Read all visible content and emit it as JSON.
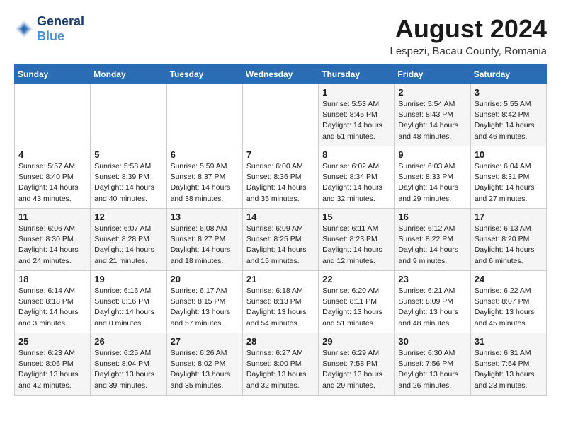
{
  "header": {
    "logo_line1": "General",
    "logo_line2": "Blue",
    "month_year": "August 2024",
    "location": "Lespezi, Bacau County, Romania"
  },
  "days_of_week": [
    "Sunday",
    "Monday",
    "Tuesday",
    "Wednesday",
    "Thursday",
    "Friday",
    "Saturday"
  ],
  "weeks": [
    [
      {
        "day": "",
        "sunrise": "",
        "sunset": "",
        "daylight": ""
      },
      {
        "day": "",
        "sunrise": "",
        "sunset": "",
        "daylight": ""
      },
      {
        "day": "",
        "sunrise": "",
        "sunset": "",
        "daylight": ""
      },
      {
        "day": "",
        "sunrise": "",
        "sunset": "",
        "daylight": ""
      },
      {
        "day": "1",
        "sunrise": "Sunrise: 5:53 AM",
        "sunset": "Sunset: 8:45 PM",
        "daylight": "Daylight: 14 hours and 51 minutes."
      },
      {
        "day": "2",
        "sunrise": "Sunrise: 5:54 AM",
        "sunset": "Sunset: 8:43 PM",
        "daylight": "Daylight: 14 hours and 48 minutes."
      },
      {
        "day": "3",
        "sunrise": "Sunrise: 5:55 AM",
        "sunset": "Sunset: 8:42 PM",
        "daylight": "Daylight: 14 hours and 46 minutes."
      }
    ],
    [
      {
        "day": "4",
        "sunrise": "Sunrise: 5:57 AM",
        "sunset": "Sunset: 8:40 PM",
        "daylight": "Daylight: 14 hours and 43 minutes."
      },
      {
        "day": "5",
        "sunrise": "Sunrise: 5:58 AM",
        "sunset": "Sunset: 8:39 PM",
        "daylight": "Daylight: 14 hours and 40 minutes."
      },
      {
        "day": "6",
        "sunrise": "Sunrise: 5:59 AM",
        "sunset": "Sunset: 8:37 PM",
        "daylight": "Daylight: 14 hours and 38 minutes."
      },
      {
        "day": "7",
        "sunrise": "Sunrise: 6:00 AM",
        "sunset": "Sunset: 8:36 PM",
        "daylight": "Daylight: 14 hours and 35 minutes."
      },
      {
        "day": "8",
        "sunrise": "Sunrise: 6:02 AM",
        "sunset": "Sunset: 8:34 PM",
        "daylight": "Daylight: 14 hours and 32 minutes."
      },
      {
        "day": "9",
        "sunrise": "Sunrise: 6:03 AM",
        "sunset": "Sunset: 8:33 PM",
        "daylight": "Daylight: 14 hours and 29 minutes."
      },
      {
        "day": "10",
        "sunrise": "Sunrise: 6:04 AM",
        "sunset": "Sunset: 8:31 PM",
        "daylight": "Daylight: 14 hours and 27 minutes."
      }
    ],
    [
      {
        "day": "11",
        "sunrise": "Sunrise: 6:06 AM",
        "sunset": "Sunset: 8:30 PM",
        "daylight": "Daylight: 14 hours and 24 minutes."
      },
      {
        "day": "12",
        "sunrise": "Sunrise: 6:07 AM",
        "sunset": "Sunset: 8:28 PM",
        "daylight": "Daylight: 14 hours and 21 minutes."
      },
      {
        "day": "13",
        "sunrise": "Sunrise: 6:08 AM",
        "sunset": "Sunset: 8:27 PM",
        "daylight": "Daylight: 14 hours and 18 minutes."
      },
      {
        "day": "14",
        "sunrise": "Sunrise: 6:09 AM",
        "sunset": "Sunset: 8:25 PM",
        "daylight": "Daylight: 14 hours and 15 minutes."
      },
      {
        "day": "15",
        "sunrise": "Sunrise: 6:11 AM",
        "sunset": "Sunset: 8:23 PM",
        "daylight": "Daylight: 14 hours and 12 minutes."
      },
      {
        "day": "16",
        "sunrise": "Sunrise: 6:12 AM",
        "sunset": "Sunset: 8:22 PM",
        "daylight": "Daylight: 14 hours and 9 minutes."
      },
      {
        "day": "17",
        "sunrise": "Sunrise: 6:13 AM",
        "sunset": "Sunset: 8:20 PM",
        "daylight": "Daylight: 14 hours and 6 minutes."
      }
    ],
    [
      {
        "day": "18",
        "sunrise": "Sunrise: 6:14 AM",
        "sunset": "Sunset: 8:18 PM",
        "daylight": "Daylight: 14 hours and 3 minutes."
      },
      {
        "day": "19",
        "sunrise": "Sunrise: 6:16 AM",
        "sunset": "Sunset: 8:16 PM",
        "daylight": "Daylight: 14 hours and 0 minutes."
      },
      {
        "day": "20",
        "sunrise": "Sunrise: 6:17 AM",
        "sunset": "Sunset: 8:15 PM",
        "daylight": "Daylight: 13 hours and 57 minutes."
      },
      {
        "day": "21",
        "sunrise": "Sunrise: 6:18 AM",
        "sunset": "Sunset: 8:13 PM",
        "daylight": "Daylight: 13 hours and 54 minutes."
      },
      {
        "day": "22",
        "sunrise": "Sunrise: 6:20 AM",
        "sunset": "Sunset: 8:11 PM",
        "daylight": "Daylight: 13 hours and 51 minutes."
      },
      {
        "day": "23",
        "sunrise": "Sunrise: 6:21 AM",
        "sunset": "Sunset: 8:09 PM",
        "daylight": "Daylight: 13 hours and 48 minutes."
      },
      {
        "day": "24",
        "sunrise": "Sunrise: 6:22 AM",
        "sunset": "Sunset: 8:07 PM",
        "daylight": "Daylight: 13 hours and 45 minutes."
      }
    ],
    [
      {
        "day": "25",
        "sunrise": "Sunrise: 6:23 AM",
        "sunset": "Sunset: 8:06 PM",
        "daylight": "Daylight: 13 hours and 42 minutes."
      },
      {
        "day": "26",
        "sunrise": "Sunrise: 6:25 AM",
        "sunset": "Sunset: 8:04 PM",
        "daylight": "Daylight: 13 hours and 39 minutes."
      },
      {
        "day": "27",
        "sunrise": "Sunrise: 6:26 AM",
        "sunset": "Sunset: 8:02 PM",
        "daylight": "Daylight: 13 hours and 35 minutes."
      },
      {
        "day": "28",
        "sunrise": "Sunrise: 6:27 AM",
        "sunset": "Sunset: 8:00 PM",
        "daylight": "Daylight: 13 hours and 32 minutes."
      },
      {
        "day": "29",
        "sunrise": "Sunrise: 6:29 AM",
        "sunset": "Sunset: 7:58 PM",
        "daylight": "Daylight: 13 hours and 29 minutes."
      },
      {
        "day": "30",
        "sunrise": "Sunrise: 6:30 AM",
        "sunset": "Sunset: 7:56 PM",
        "daylight": "Daylight: 13 hours and 26 minutes."
      },
      {
        "day": "31",
        "sunrise": "Sunrise: 6:31 AM",
        "sunset": "Sunset: 7:54 PM",
        "daylight": "Daylight: 13 hours and 23 minutes."
      }
    ]
  ]
}
